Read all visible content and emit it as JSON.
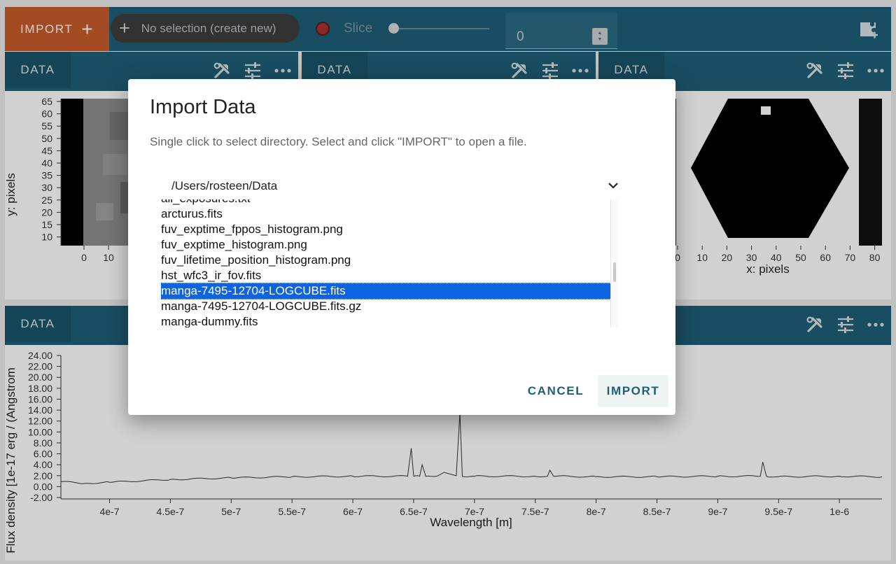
{
  "toolbar": {
    "import_label": "IMPORT",
    "selection_label": "No selection (create new)",
    "slice_label": "Slice",
    "slice_value": "0"
  },
  "panels": {
    "data_label": "DATA"
  },
  "image_viewer_left": {
    "ylabel": "y: pixels",
    "y_ticks": [
      "65",
      "60",
      "55",
      "50",
      "45",
      "40",
      "35",
      "30",
      "25",
      "20",
      "15",
      "10"
    ],
    "x_ticks": [
      "0",
      "10"
    ]
  },
  "image_viewer_right": {
    "xlabel": "x: pixels",
    "x_ticks": [
      "0",
      "10",
      "20",
      "30",
      "40",
      "50",
      "60",
      "70",
      "80"
    ]
  },
  "spectrum_viewer": {
    "xlabel": "Wavelength [m]",
    "ylabel": "Flux density [1e-17 erg / (Angstrom",
    "y_ticks": [
      "24.00",
      "22.00",
      "20.00",
      "18.00",
      "16.00",
      "14.00",
      "12.00",
      "10.00",
      "8.00",
      "6.00",
      "4.00",
      "2.00",
      "0.00",
      "-2.00"
    ],
    "x_ticks": [
      "4e-7",
      "4.5e-7",
      "5e-7",
      "5.5e-7",
      "6e-7",
      "6.5e-7",
      "7e-7",
      "7.5e-7",
      "8e-7",
      "8.5e-7",
      "9e-7",
      "9.5e-7",
      "1e-6"
    ]
  },
  "dialog": {
    "title": "Import Data",
    "subtitle": "Single click to select directory. Select and click \"IMPORT\" to open a file.",
    "directory": "/Users/rosteen/Data",
    "files": [
      "all_exposures.txt",
      "arcturus.fits",
      "fuv_exptime_fppos_histogram.png",
      "fuv_exptime_histogram.png",
      "fuv_lifetime_position_histogram.png",
      "hst_wfc3_ir_fov.fits",
      "manga-7495-12704-LOGCUBE.fits",
      "manga-7495-12704-LOGCUBE.fits.gz",
      "manga-dummy.fits"
    ],
    "selected_file": "manga-7495-12704-LOGCUBE.fits",
    "cancel_label": "CANCEL",
    "import_label": "IMPORT"
  },
  "chart_data": {
    "type": "line",
    "title": "",
    "xlabel": "Wavelength [m]",
    "ylabel": "Flux density [1e-17 erg / (Angstrom",
    "xlim": [
      3.6e-07,
      1.035e-06
    ],
    "ylim": [
      -2.0,
      24.0
    ],
    "series": [
      {
        "x": [
          3.6e-07,
          3.8e-07,
          4e-07,
          4.5e-07,
          5e-07,
          5.5e-07,
          6e-07,
          6.45e-07,
          6.48e-07,
          6.5e-07,
          6.55e-07,
          6.57e-07,
          6.6e-07,
          6.7e-07,
          6.75e-07,
          6.85e-07,
          6.88e-07,
          6.9e-07,
          7e-07,
          7.5e-07,
          7.6e-07,
          7.62e-07,
          7.65e-07,
          8e-07,
          8.5e-07,
          9e-07,
          9.35e-07,
          9.37e-07,
          9.4e-07,
          9.5e-07,
          1e-06,
          1.035e-06
        ],
        "y": [
          0.9,
          0.6,
          0.8,
          1.3,
          1.6,
          1.8,
          1.9,
          1.9,
          7.0,
          1.9,
          1.9,
          4.0,
          1.9,
          2.0,
          2.6,
          2.0,
          13.5,
          1.9,
          1.9,
          1.9,
          1.9,
          3.0,
          1.9,
          1.8,
          1.8,
          1.9,
          1.9,
          4.5,
          1.9,
          1.8,
          1.9,
          1.8
        ]
      }
    ]
  }
}
